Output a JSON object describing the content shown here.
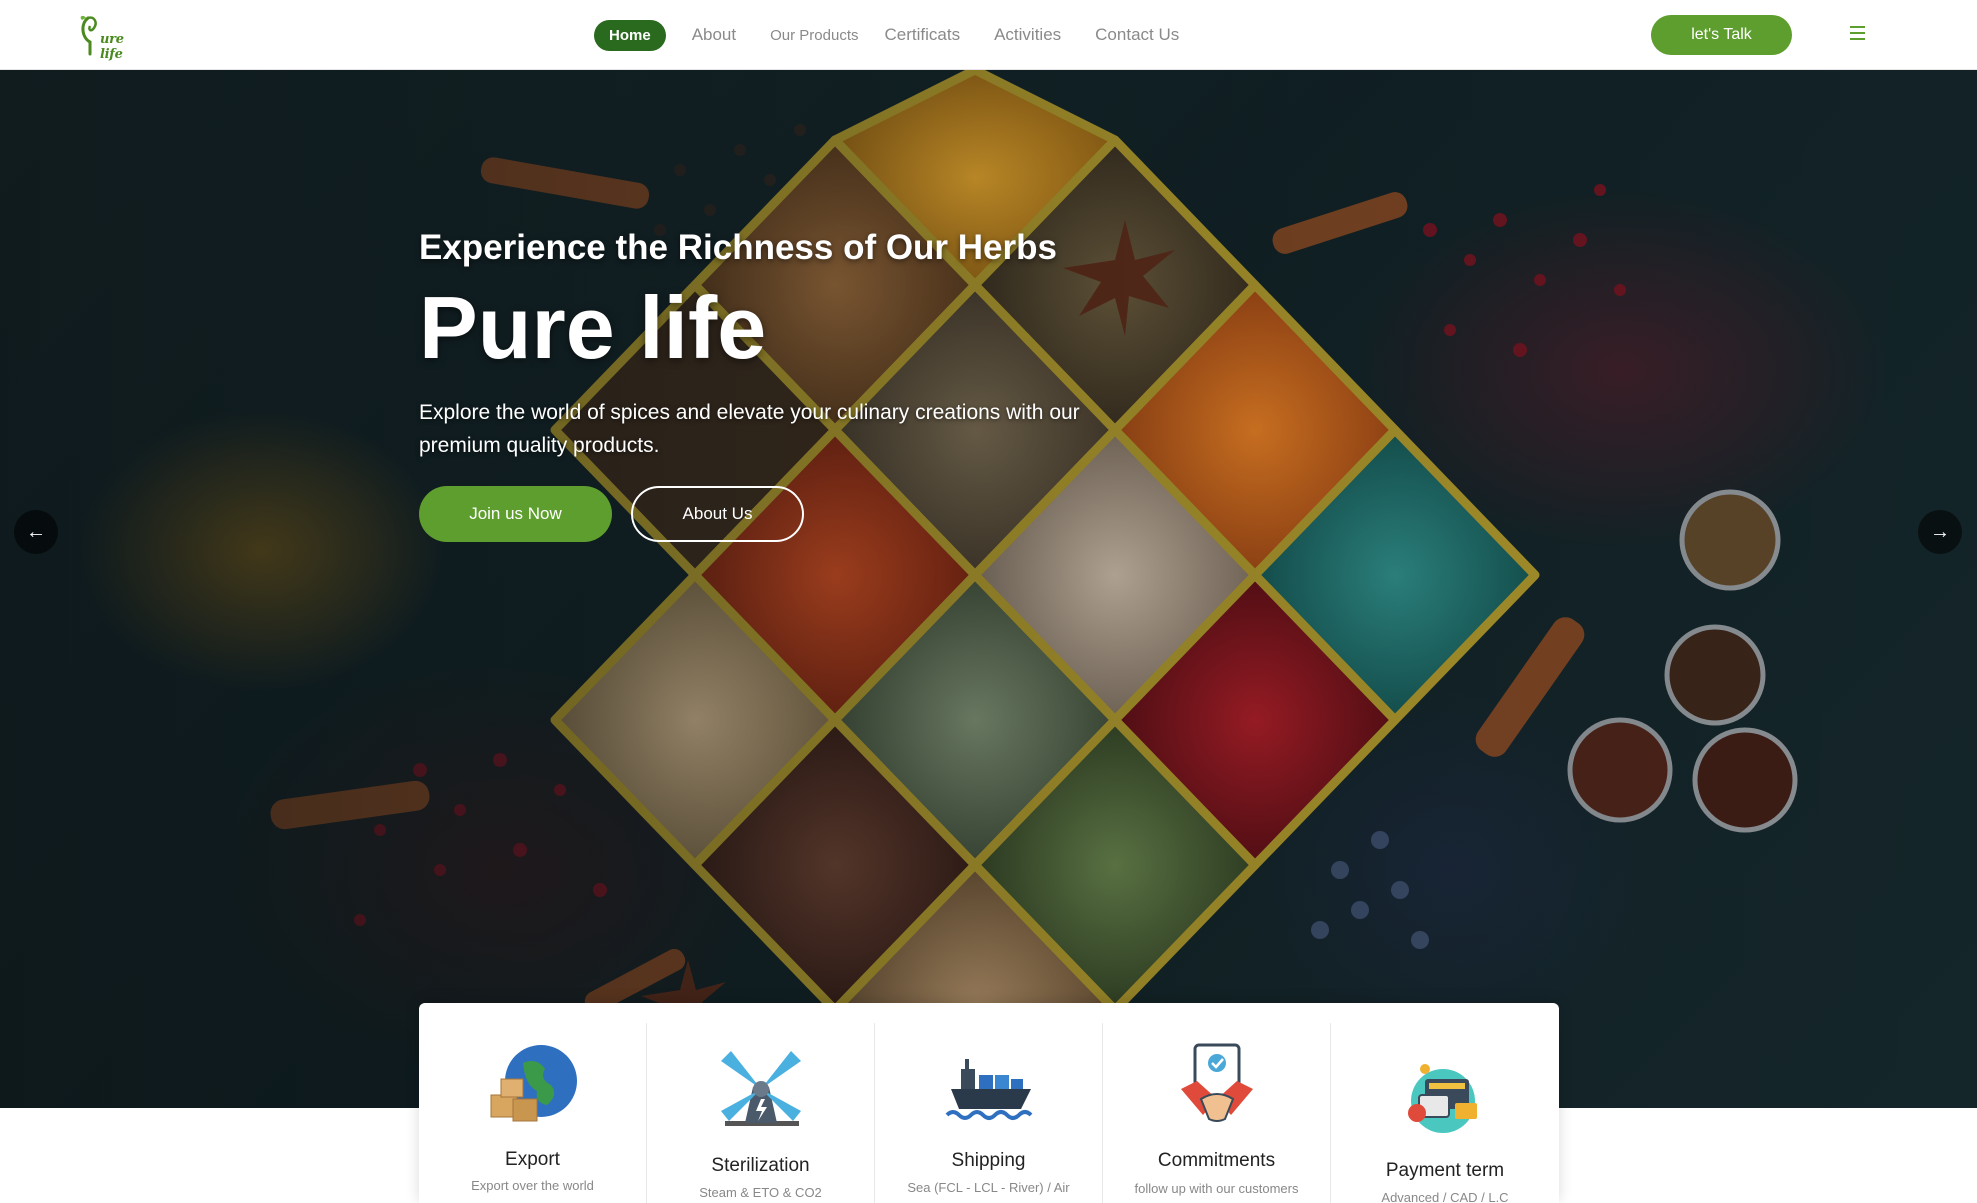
{
  "brand": {
    "logo_text": "ure life"
  },
  "nav": {
    "items": [
      {
        "label": "Home",
        "active": true
      },
      {
        "label": "About"
      },
      {
        "label": "Our Products"
      },
      {
        "label": "Certificats"
      },
      {
        "label": "Activities"
      },
      {
        "label": "Contact Us"
      }
    ],
    "cta_label": "let's Talk",
    "menu_icon": "hamburger-icon"
  },
  "hero": {
    "subtitle": "Experience the Richness of Our Herbs",
    "title": "Pure life",
    "description": "Explore the world of spices and elevate your culinary creations with our premium quality products.",
    "primary_button": "Join us Now",
    "secondary_button": "About Us",
    "prev_icon": "arrow-left-icon",
    "next_icon": "arrow-right-icon"
  },
  "features": [
    {
      "title": "Export",
      "desc": "Export over the world",
      "icon": "globe-boxes-icon"
    },
    {
      "title": "Sterilization",
      "desc": "Steam & ETO & CO2",
      "icon": "windmill-icon"
    },
    {
      "title": "Shipping",
      "desc": "Sea (FCL - LCL - River) / Air",
      "icon": "cargo-ship-icon"
    },
    {
      "title": "Commitments",
      "desc": "follow up with our customers",
      "icon": "handshake-icon"
    },
    {
      "title": "Payment term",
      "desc": "Advanced / CAD / L.C",
      "icon": "payment-icon"
    }
  ],
  "colors": {
    "brand_green": "#5d9e2e",
    "dark_green": "#2a6a1f",
    "nav_text": "#8a8a8a",
    "hero_bg": "#132328"
  }
}
